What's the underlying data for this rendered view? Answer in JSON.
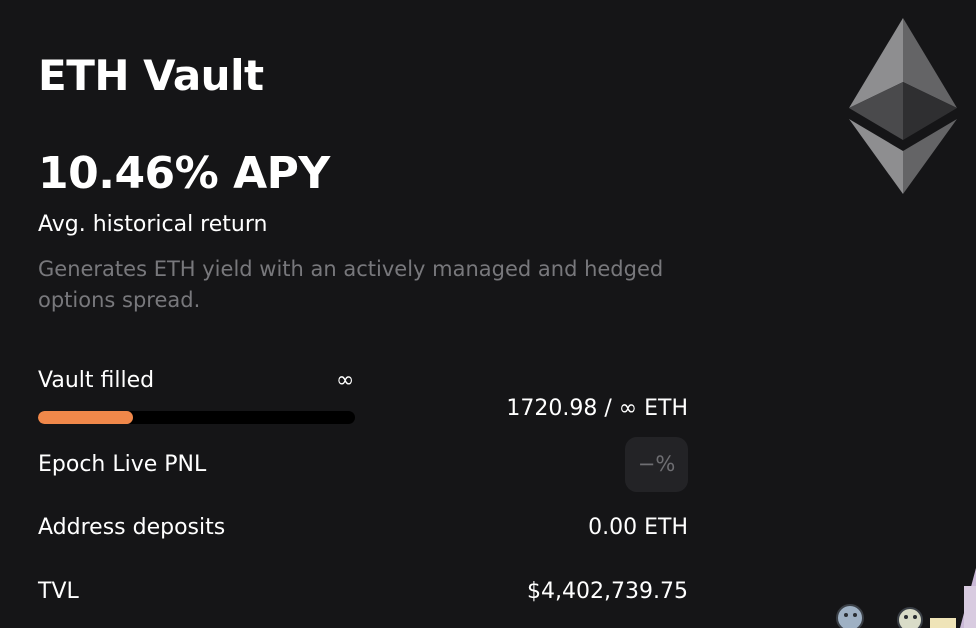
{
  "vault": {
    "title": "ETH Vault",
    "apy": "10.46% APY",
    "apy_subtitle": "Avg. historical return",
    "description": "Generates ETH yield with an actively managed and hedged options spread."
  },
  "vault_filled": {
    "label": "Vault filled",
    "cap_symbol": "∞",
    "amount": "1720.98 / ∞ ETH",
    "progress_fraction": 0.3,
    "progress_color": "#f0884a"
  },
  "epoch_pnl": {
    "label": "Epoch Live PNL",
    "value": "−%"
  },
  "address_deposits": {
    "label": "Address deposits",
    "value": "0.00 ETH"
  },
  "tvl": {
    "label": "TVL",
    "value": "$4,402,739.75"
  },
  "icons": {
    "logo": "ethereum-logo-icon"
  }
}
